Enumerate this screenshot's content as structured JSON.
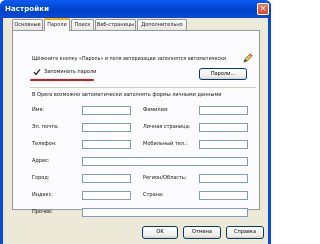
{
  "window": {
    "title": "Настройки",
    "close_glyph": "×"
  },
  "tabs": [
    {
      "label": "Основные",
      "active": false
    },
    {
      "label": "Пароли",
      "active": true
    },
    {
      "label": "Поиск",
      "active": false
    },
    {
      "label": "Веб-страницы",
      "active": false
    },
    {
      "label": "Дополнительно",
      "active": false
    }
  ],
  "passwords": {
    "hint": "Щёлкните кнопку «Пароль» и поля авторизации заполнятся автоматически",
    "save_checkbox_label": "Запоминать пароли",
    "save_checked": true,
    "passwords_button": "Пароли..."
  },
  "form": {
    "intro": "В Opera возможно автоматически заполнять формы личными данными",
    "fields": {
      "name": "Имя:",
      "surname": "Фамилия:",
      "email": "Эл. почта:",
      "homepage": "Личная страница:",
      "phone": "Телефон:",
      "mobile": "Мобильный тел.:",
      "address": "Адрес:",
      "city": "Город:",
      "region": "Регион/Область:",
      "zip": "Индекс:",
      "country": "Страна:",
      "other": "Прочее:"
    }
  },
  "footer": {
    "ok": "OK",
    "cancel": "Отмена",
    "help": "Справка"
  },
  "colors": {
    "titlebar": "#0a4ad8",
    "active_tab_accent": "#f5b100",
    "underline_mark": "#d8141a"
  },
  "icons": [
    "close-icon",
    "check-icon",
    "pen-icon"
  ]
}
